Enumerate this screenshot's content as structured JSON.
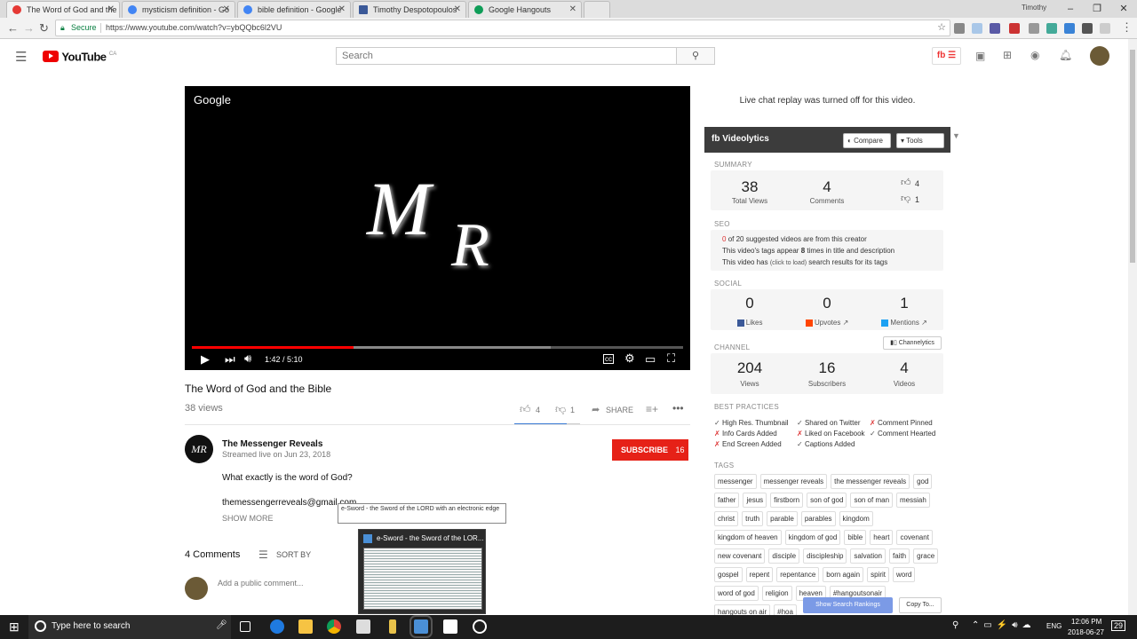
{
  "browser": {
    "tabs": [
      {
        "title": "The Word of God and the",
        "color": "#e53935",
        "active": true
      },
      {
        "title": "mysticism definition - Go",
        "color": "#4285f4",
        "active": false
      },
      {
        "title": "bible definition - Google",
        "color": "#4285f4",
        "active": false
      },
      {
        "title": "Timothy Despotopoulos",
        "color": "#3b5998",
        "active": false
      },
      {
        "title": "Google Hangouts",
        "color": "#0f9d58",
        "active": false
      }
    ],
    "user": "Timothy",
    "secure_label": "Secure",
    "url": "https://www.youtube.com/watch?v=ybQQbc6l2VU"
  },
  "youtube": {
    "logo": "YouTube",
    "logo_region": "CA",
    "search_placeholder": "Search"
  },
  "video": {
    "player_brand": "Google",
    "logo_letters_1": "M",
    "logo_letters_2": "R",
    "time": "1:42 / 5:10",
    "progress_played": 0.33,
    "progress_buffered": 0.73,
    "title": "The Word of God and the Bible",
    "views": "38 views",
    "likes": "4",
    "dislikes": "1",
    "share": "SHARE",
    "channel_name": "The Messenger Reveals",
    "streamed": "Streamed live on Jun 23, 2018",
    "subscribe": "SUBSCRIBE",
    "subscribers": "16",
    "description_1": "What exactly is the word of God?",
    "description_2": "themessengerreveals@gmail.com",
    "show_more": "SHOW MORE",
    "comments_count": "4 Comments",
    "sort_by": "SORT BY",
    "add_comment": "Add a public comment..."
  },
  "chat": {
    "replay_off": "Live chat replay was turned off for this video."
  },
  "videolytics": {
    "brand": "Videolytics",
    "compare": "Compare",
    "tools": "Tools",
    "summary_label": "SUMMARY",
    "total_views": "38",
    "total_views_label": "Total Views",
    "comments": "4",
    "comments_label": "Comments",
    "likes": "4",
    "dislikes": "1",
    "seo_label": "SEO",
    "seo_1_num": "0",
    "seo_1_text": "of 20 suggested videos are from this creator",
    "seo_2_pre": "This video's tags appear",
    "seo_2_num": "8",
    "seo_2_post": "times in title and description",
    "seo_3_pre": "This video has",
    "seo_3_link": "(click to load)",
    "seo_3_post": "search results for its tags",
    "social_label": "SOCIAL",
    "social_likes": "0",
    "social_likes_label": "Likes",
    "social_upvotes": "0",
    "social_upvotes_label": "Upvotes",
    "social_mentions": "1",
    "social_mentions_label": "Mentions",
    "channel_label": "CHANNEL",
    "channelytics": "Channelytics",
    "ch_views": "204",
    "ch_views_label": "Views",
    "ch_subs": "16",
    "ch_subs_label": "Subscribers",
    "ch_videos": "4",
    "ch_videos_label": "Videos",
    "bp_label": "BEST PRACTICES",
    "bp": [
      {
        "text": "High Res. Thumbnail",
        "ok": true
      },
      {
        "text": "Shared on Twitter",
        "ok": true
      },
      {
        "text": "Comment Pinned",
        "ok": false
      },
      {
        "text": "Info Cards Added",
        "ok": false
      },
      {
        "text": "Liked on Facebook",
        "ok": false
      },
      {
        "text": "Comment Hearted",
        "ok": true
      },
      {
        "text": "End Screen Added",
        "ok": false
      },
      {
        "text": "Captions Added",
        "ok": true
      }
    ],
    "tags_label": "TAGS",
    "tags": [
      "messenger",
      "messenger reveals",
      "the messenger reveals",
      "god",
      "father",
      "jesus",
      "firstborn",
      "son of god",
      "son of man",
      "messiah",
      "christ",
      "truth",
      "parable",
      "parables",
      "kingdom",
      "kingdom of heaven",
      "kingdom of god",
      "bible",
      "heart",
      "covenant",
      "new covenant",
      "disciple",
      "discipleship",
      "salvation",
      "faith",
      "grace",
      "gospel",
      "repent",
      "repentance",
      "born again",
      "spirit",
      "word",
      "word of god",
      "religion",
      "heaven",
      "#hangoutsonair",
      "hangouts on air",
      "#hoa"
    ],
    "show_rankings": "Show Search Rankings",
    "copy_to": "Copy To..."
  },
  "taskbar": {
    "search": "Type here to search",
    "lang": "ENG",
    "time": "12:06 PM",
    "date": "2018-06-27",
    "notif": "29",
    "preview_title": "e-Sword - the Sword of the LOR...",
    "tooltip": "e-Sword - the Sword of the LORD with an electronic edge"
  }
}
